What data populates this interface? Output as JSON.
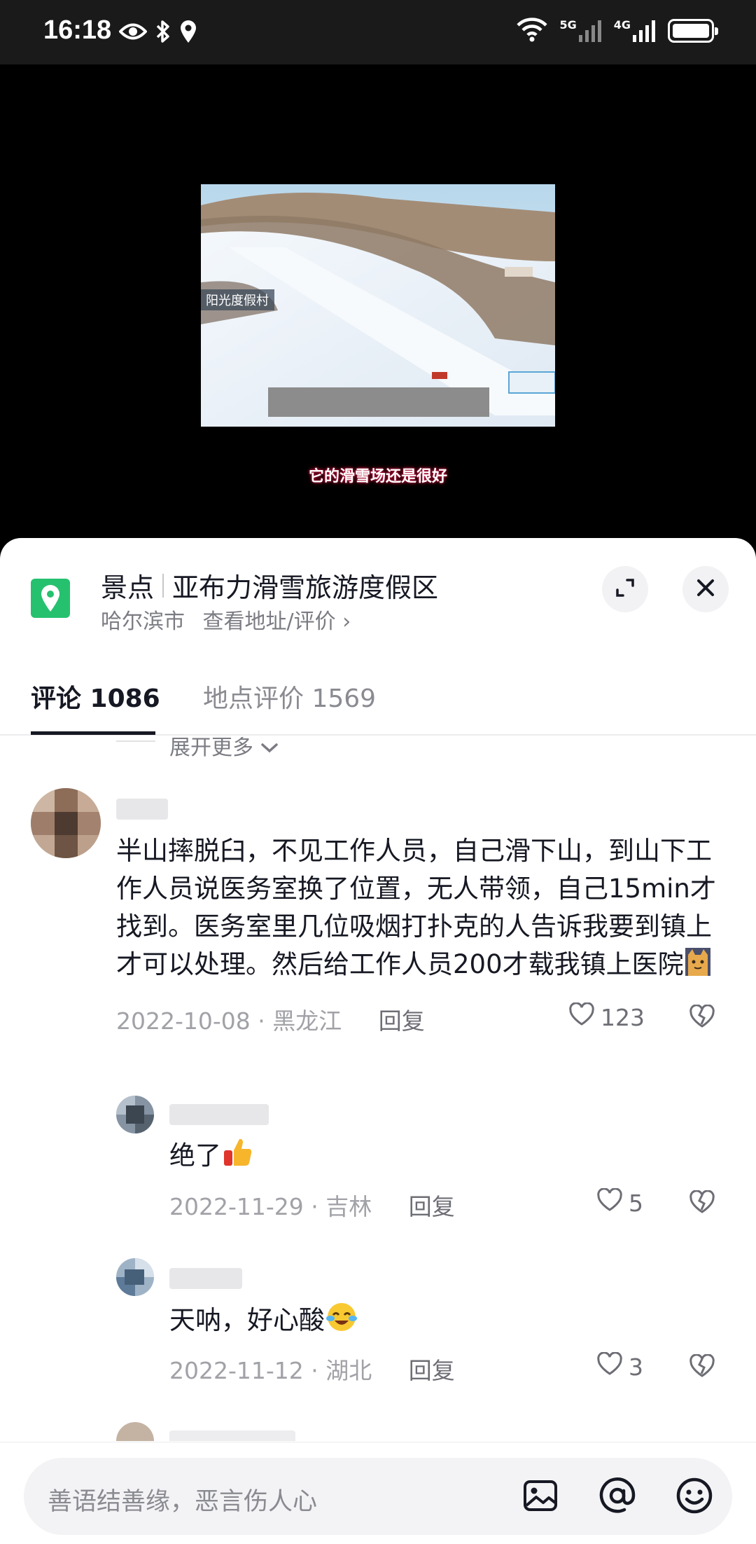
{
  "status_bar": {
    "time": "16:18",
    "net_5g": "5G",
    "net_4g": "4G",
    "icons": [
      "eye-icon",
      "bluetooth-icon",
      "location-icon",
      "wifi-icon",
      "signal-icon",
      "battery-icon"
    ]
  },
  "video": {
    "caption": "它的滑雪场还是很好",
    "sign_text": "阳光度假村"
  },
  "place": {
    "category": "景点",
    "name": "亚布力滑雪旅游度假区",
    "city": "哈尔滨市",
    "link": "查看地址/评价 ›",
    "pin_color": "#25c16f"
  },
  "tabs": {
    "comments": "评论 1086",
    "reviews": "地点评价 1569"
  },
  "comments": {
    "expand_more": "展开更多",
    "items": [
      {
        "text": "半山摔脱臼，不见工作人员，自己滑下山，到山下工作人员说医务室换了位置，无人带领，自己15min才找到。医务室里几位吸烟打扑克的人告诉我要到镇上才可以处理。然后给工作人员200才载我镇上医院",
        "date": "2022-10-08",
        "region": "黑龙江",
        "reply": "回复",
        "likes": "123"
      },
      {
        "text": "绝了",
        "date": "2022-11-29",
        "region": "吉林",
        "reply": "回复",
        "likes": "5"
      },
      {
        "text": "天呐，好心酸",
        "date": "2022-11-12",
        "region": "湖北",
        "reply": "回复",
        "likes": "3"
      }
    ]
  },
  "input": {
    "placeholder": "善语结善缘，恶言伤人心"
  }
}
